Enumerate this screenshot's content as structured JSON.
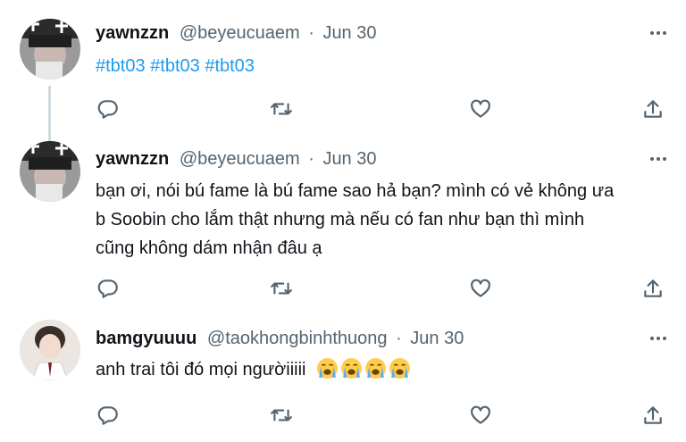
{
  "tweets": [
    {
      "name": "yawnzzn",
      "handle": "@beyeucuaem",
      "sep": "·",
      "date": "Jun 30",
      "text": "#tbt03 #tbt03 #tbt03"
    },
    {
      "name": "yawnzzn",
      "handle": "@beyeucuaem",
      "sep": "·",
      "date": "Jun 30",
      "lines": [
        "bạn ơi, nói bú fame là bú fame sao hả bạn? mình có vẻ không ưa",
        "b Soobin cho lắm thật nhưng mà nếu có fan như bạn thì mình",
        "cũng không dám nhận đâu ạ"
      ]
    },
    {
      "name": "bamgyuuuu",
      "handle": "@taokhongbinhthuong",
      "sep": "·",
      "date": "Jun 30",
      "text": "anh trai tôi đó mọi ngườiiiii",
      "emoji": [
        "loudly-crying-face",
        "loudly-crying-face",
        "loudly-crying-face",
        "loudly-crying-face"
      ]
    }
  ],
  "icons": {
    "reply": "reply-icon",
    "retweet": "retweet-icon",
    "like": "like-icon",
    "share": "share-icon",
    "more": "more-icon"
  },
  "colors": {
    "link": "#1d9bf0",
    "muted": "#536471",
    "text": "#0f1419",
    "thread": "#cfd9de"
  }
}
